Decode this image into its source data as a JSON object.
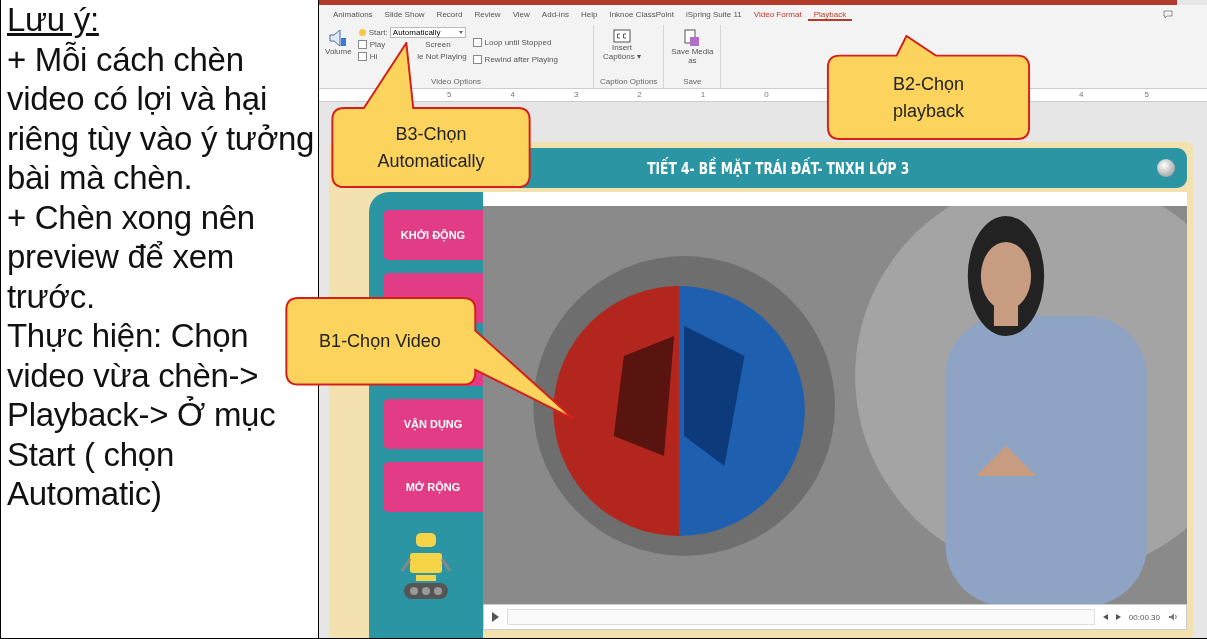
{
  "note": {
    "title": "Lưu ý:",
    "paragraphs": [
      "+ Mỗi cách chèn video có lợi và hại riêng tùy vào ý tưởng bài mà chèn.",
      "+ Chèn xong nên preview để xem trước.",
      "Thực hiện: Chọn video vừa chèn-> Playback-> Ở mục Start ( chọn Automatic)"
    ]
  },
  "ribbon": {
    "tabs": [
      {
        "label": "Animations",
        "selected": false,
        "contextual": false
      },
      {
        "label": "Slide Show",
        "selected": false,
        "contextual": false
      },
      {
        "label": "Record",
        "selected": false,
        "contextual": false
      },
      {
        "label": "Review",
        "selected": false,
        "contextual": false
      },
      {
        "label": "View",
        "selected": false,
        "contextual": false
      },
      {
        "label": "Add-ins",
        "selected": false,
        "contextual": false
      },
      {
        "label": "Help",
        "selected": false,
        "contextual": false
      },
      {
        "label": "Inknoe ClassPoint",
        "selected": false,
        "contextual": false
      },
      {
        "label": "iSpring Suite 11",
        "selected": false,
        "contextual": false
      },
      {
        "label": "Video Format",
        "selected": false,
        "contextual": true
      },
      {
        "label": "Playback",
        "selected": true,
        "contextual": true
      }
    ],
    "volume_label": "Volume",
    "start_label": "Start:",
    "start_value": "Automatically",
    "left_checks": [
      {
        "label": "Play",
        "label_tail": "Screen",
        "checked": false
      },
      {
        "label": "Hi",
        "label_tail": "le Not Playing",
        "checked": false
      }
    ],
    "right_checks": [
      {
        "label": "Loop until Stopped",
        "checked": false
      },
      {
        "label": "Rewind after Playing",
        "checked": false
      }
    ],
    "video_options_label": "Video Options",
    "captions_button": "Insert Captions ▾",
    "caption_group_label": "Caption Options",
    "save_button": "Save Media as",
    "save_group_label": "Save"
  },
  "ruler": {
    "left_numbers": [
      "5",
      "4",
      "3",
      "2",
      "1",
      "0"
    ],
    "right_numbers": [
      "4",
      "5"
    ]
  },
  "slide": {
    "title": "TIẾT 4- BỀ MẶT TRÁI ĐẤT- TNXH LỚP 3",
    "menu": [
      {
        "kind": "button",
        "label": "KHỞI ĐỘNG"
      },
      {
        "kind": "button"
      },
      {
        "kind": "button"
      },
      {
        "kind": "button",
        "label": "VẬN DỤNG"
      },
      {
        "kind": "button",
        "label": "MỞ RỘNG"
      }
    ],
    "video": {
      "kind": "picture",
      "time": "00:00.30"
    }
  },
  "callouts": [
    {
      "text": "B2-Chọn playback",
      "kind": "up"
    },
    {
      "text": "B3-Chọn Automatically",
      "kind": "up"
    },
    {
      "text": "B1-Chọn Video",
      "kind": "right"
    }
  ]
}
